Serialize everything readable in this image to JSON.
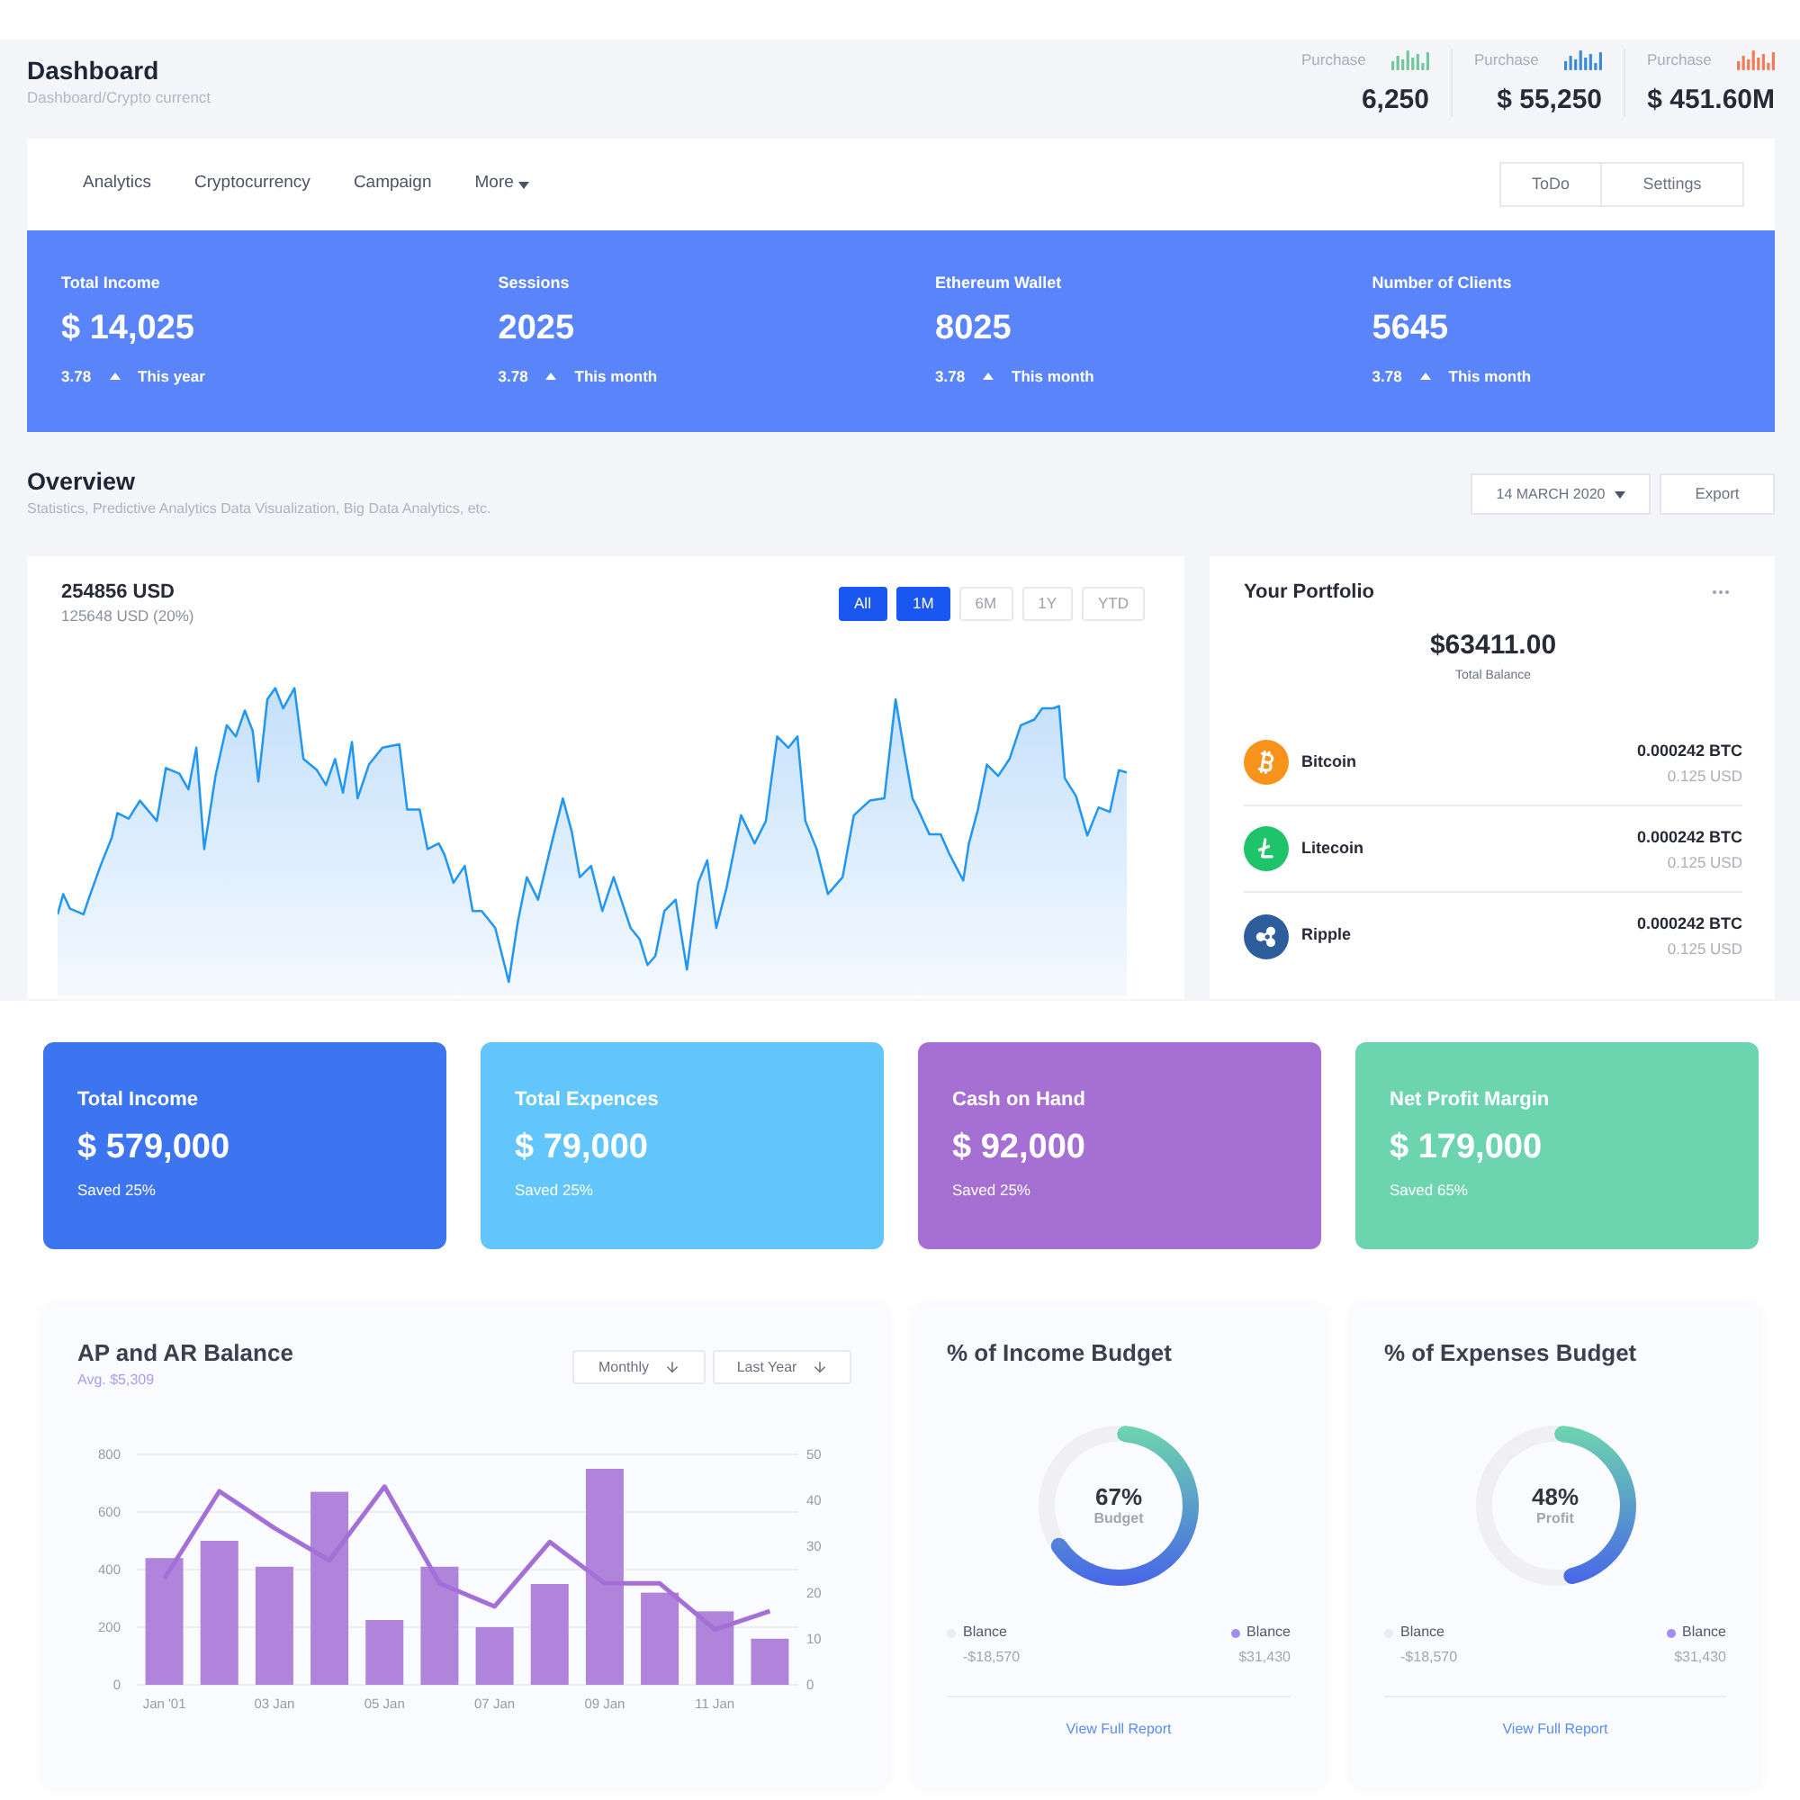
{
  "header": {
    "title": "Dashboard",
    "breadcrumb": "Dashboard/Crypto currenct",
    "stats": [
      {
        "label": "Purchase",
        "value": "6,250",
        "color": "#74c69d"
      },
      {
        "label": "Purchase",
        "value": "$ 55,250",
        "color": "#3b8ad9"
      },
      {
        "label": "Purchase",
        "value": "$ 451.60M",
        "color": "#f27c55"
      }
    ]
  },
  "nav": {
    "items": [
      {
        "label": "Analytics",
        "kind": "link"
      },
      {
        "label": "Cryptocurrency",
        "kind": "link"
      },
      {
        "label": "Campaign",
        "kind": "link"
      },
      {
        "label": "More",
        "kind": "dropdown"
      }
    ],
    "buttons": [
      "ToDo",
      "Settings"
    ]
  },
  "summary": [
    {
      "label": "Total Income",
      "value": "$ 14,025",
      "change": "3.78",
      "period": "This year"
    },
    {
      "label": "Sessions",
      "value": "2025",
      "change": "3.78",
      "period": "This month"
    },
    {
      "label": "Ethereum Wallet",
      "value": "8025",
      "change": "3.78",
      "period": "This month"
    },
    {
      "label": "Number of Clients",
      "value": "5645",
      "change": "3.78",
      "period": "This month"
    }
  ],
  "overview": {
    "title": "Overview",
    "subtitle": "Statistics, Predictive Analytics Data Visualization, Big Data Analytics, etc.",
    "date": "14 MARCH 2020",
    "export": "Export"
  },
  "price_chart": {
    "value": "254856 USD",
    "change": "125648 USD (20%)",
    "ranges": [
      {
        "label": "All",
        "selected": true
      },
      {
        "label": "1M",
        "selected": true
      },
      {
        "label": "6M",
        "selected": false
      },
      {
        "label": "1Y",
        "selected": false
      },
      {
        "label": "YTD",
        "selected": false
      }
    ]
  },
  "portfolio": {
    "title": "Your Portfolio",
    "balance": "$63411.00",
    "balance_label": "Total Balance",
    "coins": [
      {
        "name": "Bitcoin",
        "color": "#f7931a",
        "amount": "0.000242 BTC",
        "usd": "0.125 USD"
      },
      {
        "name": "Litecoin",
        "color": "#1fc46a",
        "amount": "0.000242 BTC",
        "usd": "0.125 USD"
      },
      {
        "name": "Ripple",
        "color": "#2e5d9c",
        "amount": "0.000242 BTC",
        "usd": "0.125 USD"
      }
    ]
  },
  "cards": [
    {
      "title": "Total Income",
      "value": "$ 579,000",
      "note": "Saved 25%",
      "color": "#3d74ef"
    },
    {
      "title": "Total Expences",
      "value": "$ 79,000",
      "note": "Saved 25%",
      "color": "#62c6fc"
    },
    {
      "title": "Cash on Hand",
      "value": "$ 92,000",
      "note": "Saved 25%",
      "color": "#a66fd4"
    },
    {
      "title": "Net Profit Margin",
      "value": "$ 179,000",
      "note": "Saved 65%",
      "color": "#6dd4b0"
    }
  ],
  "ap_ar": {
    "title": "AP and AR Balance",
    "subtitle": "Avg. $5,309",
    "filters": [
      "Monthly",
      "Last Year"
    ],
    "chart_data": {
      "type": "bar",
      "categories": [
        "Jan '01",
        null,
        "03 Jan",
        null,
        "05 Jan",
        null,
        "07 Jan",
        null,
        "09 Jan",
        null,
        "11 Jan",
        null
      ],
      "ylim": [
        0,
        800
      ],
      "yticks": [
        0,
        200,
        400,
        600,
        800
      ],
      "y2lim": [
        0,
        50
      ],
      "y2ticks": [
        0,
        10,
        20,
        30,
        40,
        50
      ],
      "grid": true,
      "series": [
        {
          "color": "#b084da",
          "values": [
            440,
            500,
            410,
            670,
            225,
            410,
            200,
            350,
            750,
            320,
            255,
            160
          ]
        },
        {
          "type": "line",
          "axis": "y2",
          "color": "#a470d8",
          "values": [
            23,
            42,
            34,
            27,
            43,
            22,
            17,
            31,
            22,
            22,
            12,
            16
          ]
        }
      ]
    }
  },
  "budgets": [
    {
      "title": "% of Income Budget",
      "percent": "67%",
      "caption": "Budget",
      "chart_data": {
        "type": "donut",
        "values": [
          67,
          33
        ]
      },
      "legend": [
        {
          "label": "Blance",
          "value": "-$18,570",
          "color": "#ebebf7"
        },
        {
          "label": "Blance",
          "value": "$31,430",
          "color": "#a58df0"
        }
      ],
      "link": "View Full Report"
    },
    {
      "title": "% of Expenses Budget",
      "percent": "48%",
      "caption": "Profit",
      "chart_data": {
        "type": "donut",
        "values": [
          48,
          52
        ]
      },
      "legend": [
        {
          "label": "Blance",
          "value": "-$18,570",
          "color": "#ebebf7"
        },
        {
          "label": "Blance",
          "value": "$31,430",
          "color": "#a58df0"
        }
      ],
      "link": "View Full Report"
    }
  ]
}
